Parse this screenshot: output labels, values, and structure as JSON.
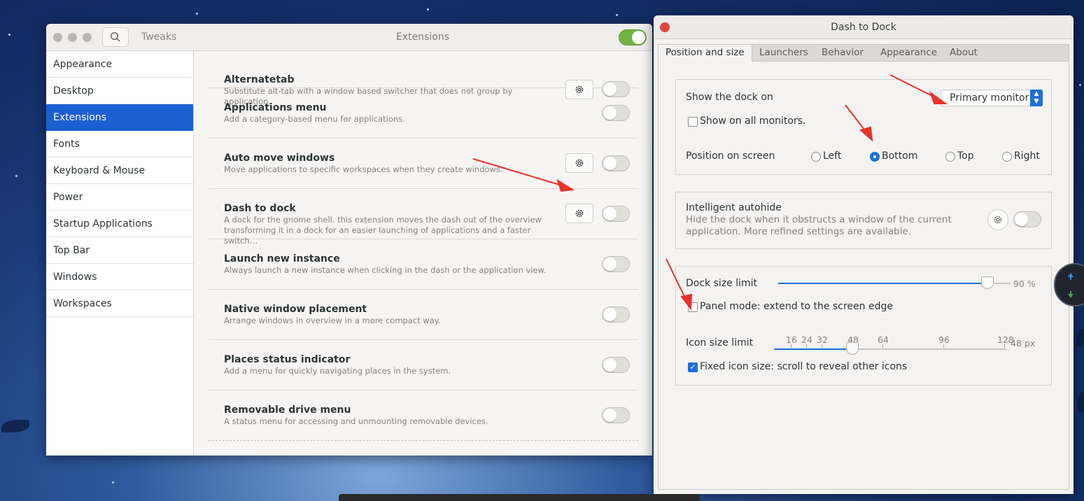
{
  "tweaks": {
    "app_name": "Tweaks",
    "title": "Extensions",
    "extensions_enabled": true,
    "sidebar": [
      {
        "label": "Appearance",
        "active": false
      },
      {
        "label": "Desktop",
        "active": false
      },
      {
        "label": "Extensions",
        "active": true
      },
      {
        "label": "Fonts",
        "active": false
      },
      {
        "label": "Keyboard & Mouse",
        "active": false
      },
      {
        "label": "Power",
        "active": false
      },
      {
        "label": "Startup Applications",
        "active": false
      },
      {
        "label": "Top Bar",
        "active": false
      },
      {
        "label": "Windows",
        "active": false
      },
      {
        "label": "Workspaces",
        "active": false
      }
    ],
    "extensions": [
      {
        "name": "Alternatetab",
        "desc": "Substitute alt-tab with a window based switcher that does not group by application.",
        "settings": true,
        "enabled": false
      },
      {
        "name": "Applications menu",
        "desc": "Add a category-based menu for applications.",
        "settings": false,
        "enabled": false
      },
      {
        "name": "Auto move windows",
        "desc": "Move applications to specific workspaces when they create windows.",
        "settings": true,
        "enabled": false
      },
      {
        "name": "Dash to dock",
        "desc": "A dock for the gnome shell. this extension moves the dash out of the overview transforming it in a dock for an easier launching of applications and a faster switch…",
        "settings": true,
        "enabled": false
      },
      {
        "name": "Launch new instance",
        "desc": "Always launch a new instance when clicking in the dash or the application view.",
        "settings": false,
        "enabled": false
      },
      {
        "name": "Native window placement",
        "desc": "Arrange windows in overview in a more compact way.",
        "settings": false,
        "enabled": false
      },
      {
        "name": "Places status indicator",
        "desc": "Add a menu for quickly navigating places in the system.",
        "settings": false,
        "enabled": false
      },
      {
        "name": "Removable drive menu",
        "desc": "A status menu for accessing and unmounting removable devices.",
        "settings": false,
        "enabled": false
      }
    ]
  },
  "dtd": {
    "title": "Dash to Dock",
    "tabs": [
      "Position and size",
      "Launchers",
      "Behavior",
      "Appearance",
      "About"
    ],
    "active_tab": "Position and size",
    "show_dock_on_label": "Show the dock on",
    "monitor_value": "Primary monitor",
    "show_all_monitors_label": "Show on all monitors.",
    "show_all_monitors": false,
    "position_label": "Position on screen",
    "positions": [
      {
        "label": "Left",
        "selected": false
      },
      {
        "label": "Bottom",
        "selected": true
      },
      {
        "label": "Top",
        "selected": false
      },
      {
        "label": "Right",
        "selected": false
      }
    ],
    "autohide_label": "Intelligent autohide",
    "autohide_desc": "Hide the dock when it obstructs a window of the current application. More refined settings are available.",
    "autohide_enabled": false,
    "dock_size_label": "Dock size limit",
    "dock_size_value": "90 %",
    "dock_size_fraction": 0.9,
    "panel_mode_label": "Panel mode: extend to the screen edge",
    "panel_mode": false,
    "icon_size_label": "Icon size limit",
    "icon_marks": [
      "16",
      "24",
      "32",
      "48",
      "64",
      "96",
      "128"
    ],
    "icon_size_value": "48 px",
    "fixed_icon_label": "Fixed icon size: scroll to reveal other icons",
    "fixed_icon": true
  },
  "colors": {
    "accent": "#1c6fd6",
    "sidebar_active": "#1c5fd1",
    "switch_on": "#73b343",
    "close_button": "#e0463c",
    "annotation_arrow": "#e8322a"
  }
}
